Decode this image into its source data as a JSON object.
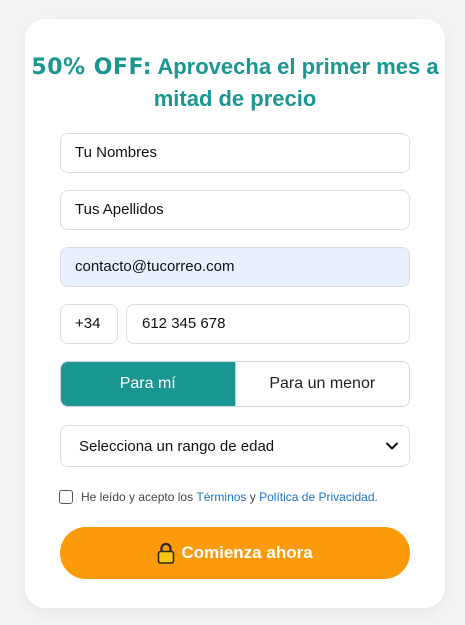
{
  "headline": {
    "promo": "50% OFF:",
    "text": " Aprovecha el primer mes a mitad de precio"
  },
  "form": {
    "first_name": "Tu Nombres",
    "last_name": "Tus Apellidos",
    "email": "contacto@tucorreo.com",
    "phone_prefix": "+34",
    "phone": "612 345 678",
    "toggle": {
      "option_self": "Para mí",
      "option_minor": "Para un menor",
      "selected": "Para mí"
    },
    "age_select": {
      "selected_label": "Selecciona un rango de edad"
    },
    "consent": {
      "prefix": "He leído y acepto los",
      "terms_link": "Términos",
      "conjunction": "y",
      "privacy_link": "Política de Privacidad",
      "suffix": ".",
      "checked": false
    },
    "submit": {
      "label": "Comienza ahora",
      "icon": "lock-icon"
    }
  },
  "colors": {
    "accent": "#1a9693",
    "cta": "#fb9a0a",
    "link": "#1a73c8",
    "autofill": "#e8f0fe"
  }
}
